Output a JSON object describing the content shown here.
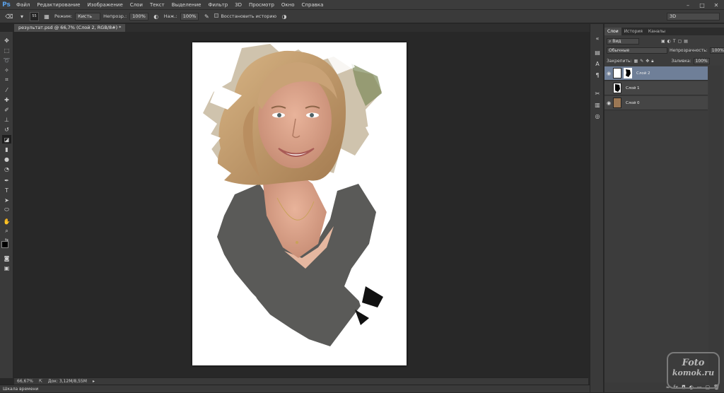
{
  "app": {
    "logo": "Ps"
  },
  "menu": [
    "Файл",
    "Редактирование",
    "Изображение",
    "Слои",
    "Текст",
    "Выделение",
    "Фильтр",
    "3D",
    "Просмотр",
    "Окно",
    "Справка"
  ],
  "window_controls": [
    "–",
    "□",
    "✕"
  ],
  "options": {
    "brush_size": "55",
    "mode_label": "Режим:",
    "mode_value": "Кисть",
    "opacity_label": "Непрозр.:",
    "opacity_value": "100%",
    "flow_label": "Наж.:",
    "flow_value": "100%",
    "restore_history": "Восстановить историю",
    "workspace": "3D"
  },
  "document_tab": "результат.psd @ 66,7% (Слой 2, RGB/8#) *",
  "status": {
    "zoom": "66,67%",
    "doc_info": "Док: 3,12М/8,55М"
  },
  "timeline_label": "Шкала времени",
  "panel": {
    "tabs": [
      "Слои",
      "История",
      "Каналы"
    ],
    "kind_label": "Вид",
    "blend_mode": "Обычные",
    "opacity_label": "Непрозрачность:",
    "opacity_value": "100%",
    "lock_label": "Закрепить:",
    "fill_label": "Заливка:",
    "fill_value": "100%",
    "layers": [
      {
        "name": "Слой 2",
        "selected": true
      },
      {
        "name": "Слой 1",
        "selected": false
      },
      {
        "name": "Слой 0",
        "selected": false
      }
    ],
    "bottom_icons": [
      "link-icon",
      "fx-icon",
      "mask-icon",
      "adjustment-icon",
      "folder-icon",
      "new-layer-icon",
      "trash-icon"
    ]
  },
  "watermark": {
    "line1": "Foto",
    "line2": "komok.ru"
  },
  "colors": {
    "accent": "#6f7f98",
    "canvas_bg": "#282828",
    "panel_bg": "#3c3c3c"
  }
}
